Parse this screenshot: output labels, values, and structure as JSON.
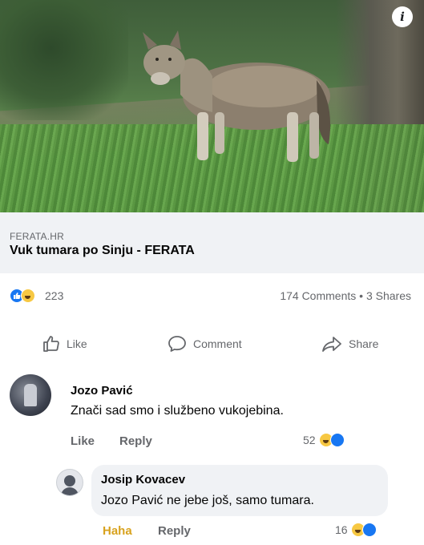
{
  "post": {
    "link_source": "FERATA.HR",
    "link_title": "Vuk tumara po Sinju - FERATA",
    "reaction_count": "223",
    "comments": "174 Comments",
    "separator": "•",
    "shares": "3 Shares"
  },
  "actions": {
    "like": "Like",
    "comment": "Comment",
    "share": "Share"
  },
  "comment": {
    "author": "Jozo Pavić",
    "text": "Znači sad smo i službeno vukojebina.",
    "like_label": "Like",
    "reply_label": "Reply",
    "reaction_count": "52"
  },
  "reply": {
    "author": "Josip Kovacev",
    "mention": "Jozo Pavić",
    "text": " ne jebe još, samo tumara.",
    "reaction_label": "Haha",
    "reply_label": "Reply",
    "reaction_count": "16"
  },
  "icons": {
    "info": "info-icon",
    "like": "thumbs-up-icon",
    "comment": "comment-bubble-icon",
    "share": "share-arrow-icon"
  },
  "colors": {
    "like_blue": "#1877f2",
    "haha_yellow": "#f7c843",
    "haha_label": "#d8a21e",
    "muted_text": "#65676b"
  }
}
